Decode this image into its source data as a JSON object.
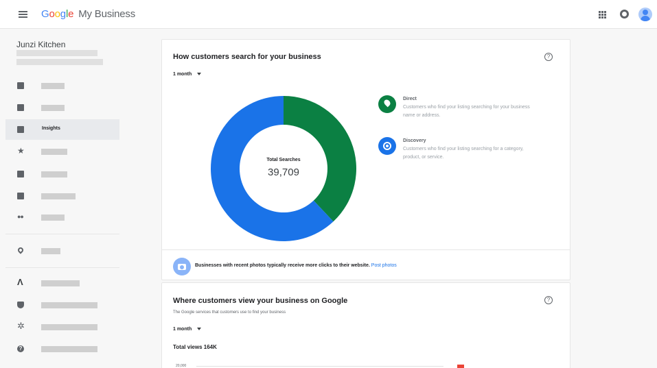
{
  "app": {
    "logo_google": [
      "G",
      "o",
      "o",
      "g",
      "l",
      "e"
    ],
    "logo_product": "My Business"
  },
  "sidebar": {
    "business_name": "Junzi Kitchen",
    "active_item_label": "Insights"
  },
  "search_card": {
    "title": "How customers search for your business",
    "period": "1 month",
    "help": "?",
    "center_label": "Total Searches",
    "center_value": "39,709",
    "legend": [
      {
        "name": "Direct",
        "description": "Customers who find your listing searching for your business name or address.",
        "color": "#0b8043"
      },
      {
        "name": "Discovery",
        "description": "Customers who find your listing searching for a category, product, or service.",
        "color": "#1a73e8"
      }
    ],
    "tip_text": "Businesses with recent photos typically receive more clicks to their website.",
    "tip_link": "Post photos"
  },
  "view_card": {
    "title": "Where customers view your business on Google",
    "subtitle": "The Google services that customers use to find your business",
    "period": "1 month",
    "help": "?",
    "total_views": "Total views 164K",
    "tick_label": "20,000"
  },
  "chart_data": {
    "type": "pie",
    "labels": [
      "Direct",
      "Discovery"
    ],
    "values": [
      0.38,
      0.62
    ],
    "colors": [
      "#0b8043",
      "#1a73e8"
    ],
    "donut": true
  }
}
